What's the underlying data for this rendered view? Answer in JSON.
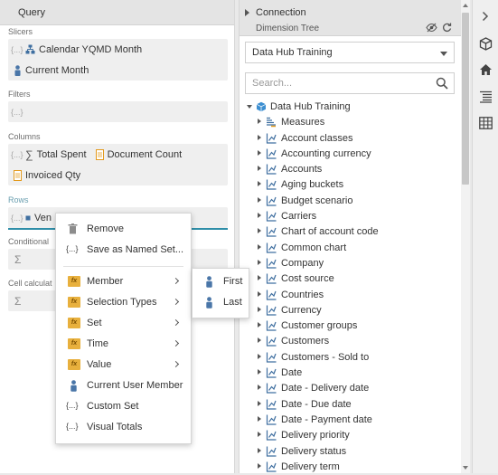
{
  "query": {
    "title": "Query",
    "slicers": {
      "label": "Slicers",
      "items": [
        "Calendar YQMD Month",
        "Current Month"
      ]
    },
    "filters": {
      "label": "Filters"
    },
    "columns": {
      "label": "Columns",
      "items": [
        "Total Spent",
        "Document Count",
        "Invoiced Qty"
      ]
    },
    "rows": {
      "label": "Rows",
      "items": [
        "Ven"
      ]
    },
    "conditional": {
      "label": "Conditional"
    },
    "cell_calc": {
      "label": "Cell calculat"
    },
    "brace": "{...}",
    "sigma": "Σ"
  },
  "connection": {
    "title": "Connection",
    "dimension_tree_title": "Dimension Tree",
    "selected_cube": "Data Hub Training",
    "search_placeholder": "Search...",
    "root": "Data Hub Training",
    "items": [
      "Measures",
      "Account classes",
      "Accounting currency",
      "Accounts",
      "Aging buckets",
      "Budget scenario",
      "Carriers",
      "Chart of account code",
      "Common chart",
      "Company",
      "Cost source",
      "Countries",
      "Currency",
      "Customer groups",
      "Customers",
      "Customers - Sold to",
      "Date",
      "Date - Delivery date",
      "Date - Due date",
      "Date - Payment date",
      "Delivery priority",
      "Delivery status",
      "Delivery term"
    ]
  },
  "context_menu": {
    "items": [
      "Remove",
      "Save as Named Set...",
      "Member",
      "Selection Types",
      "Set",
      "Time",
      "Value",
      "Current User Member",
      "Custom Set",
      "Visual Totals"
    ],
    "fx_glyph": "fx",
    "brace": "{...}"
  },
  "submenu": {
    "items": [
      "First",
      "Last"
    ]
  },
  "colors": {
    "accent": "#2f8ea8",
    "cube": "#3d8fd1",
    "hierarchy": "#3f6fa0",
    "fx_folder": "#e8b03d",
    "member": "#4a76a8"
  }
}
